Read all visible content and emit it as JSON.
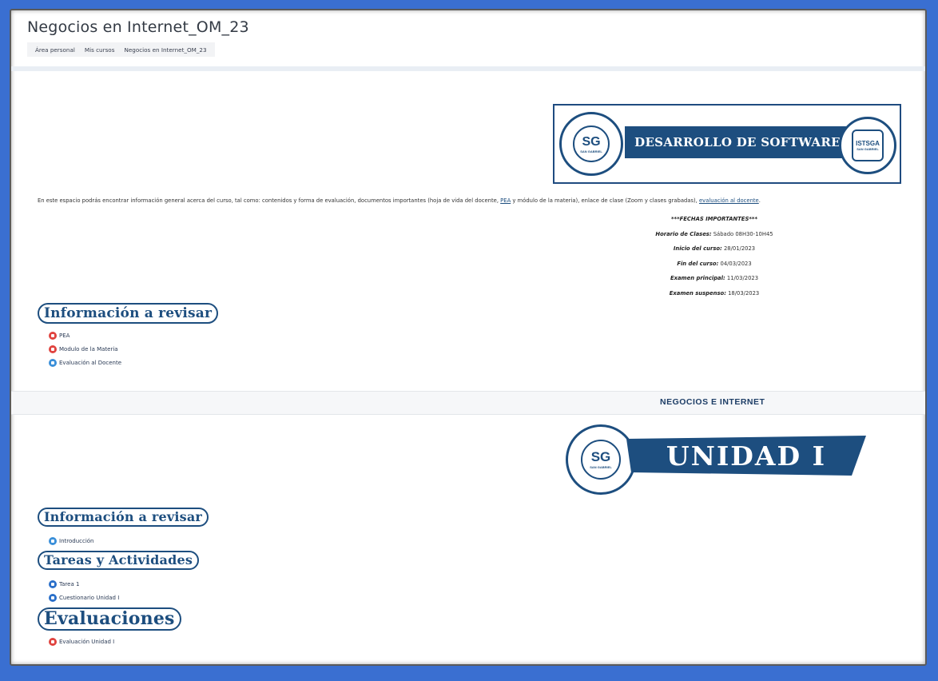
{
  "header": {
    "title": "Negocios en Internet_OM_23",
    "breadcrumb": [
      "Área personal",
      "Mis cursos",
      "Negocios en Internet_OM_23"
    ]
  },
  "banner1": {
    "text": "DESARROLLO DE SOFTWARE",
    "left_logo_text": "SG",
    "left_logo_sub": "SAN GABRIEL",
    "right_logo_text": "ISTSGA",
    "right_logo_sub": "SAN GABRIEL"
  },
  "intro": {
    "text_before": "En este espacio podrás encontrar información general acerca del curso, tal como: contenidos y forma de evaluación, documentos importantes (hoja de vida del docente, ",
    "link_pea": "PEA",
    "text_middle": " y módulo de la materia), enlace de clase (Zoom y clases grabadas), ",
    "link_eval": "evaluación al docente",
    "text_after": "."
  },
  "dates": {
    "heading": "***FECHAS IMPORTANTES***",
    "horario_label": "Horario de Clases:",
    "horario_value": " Sábado 08H30-10H45",
    "inicio_label": "Inicio del curso:",
    "inicio_value": " 28/01/2023",
    "fin_label": "Fin del curso:",
    "fin_value": " 04/03/2023",
    "principal_label": "Examen principal:",
    "principal_value": " 11/03/2023",
    "suspenso_label": "Examen suspenso:",
    "suspenso_value": " 18/03/2023"
  },
  "section0": {
    "heading": "Información a revisar",
    "items": [
      {
        "label": "PEA",
        "icon": "pdf-icon",
        "color": "#e0433f"
      },
      {
        "label": "Modulo de la Materia",
        "icon": "pdf-icon",
        "color": "#e0433f"
      },
      {
        "label": "Evaluación al Docente",
        "icon": "link-icon",
        "color": "#3a8fd9"
      }
    ]
  },
  "section1": {
    "label": "NEGOCIOS E INTERNET",
    "unit_banner": "UNIDAD I",
    "info_heading": "Información a revisar",
    "info_items": [
      {
        "label": "Introducción",
        "icon": "link-icon"
      }
    ],
    "tasks_heading": "Tareas y Actividades",
    "tasks_items": [
      {
        "label": "Tarea 1",
        "icon": "assignment-icon"
      },
      {
        "label": "Cuestionario Unidad I",
        "icon": "quiz-icon"
      }
    ],
    "eval_heading": "Evaluaciones",
    "eval_items": [
      {
        "label": "Evaluación Unidad I",
        "icon": "quiz-icon"
      }
    ]
  },
  "colors": {
    "brand": "#1d4e7f",
    "frame": "#3a6fd1"
  }
}
